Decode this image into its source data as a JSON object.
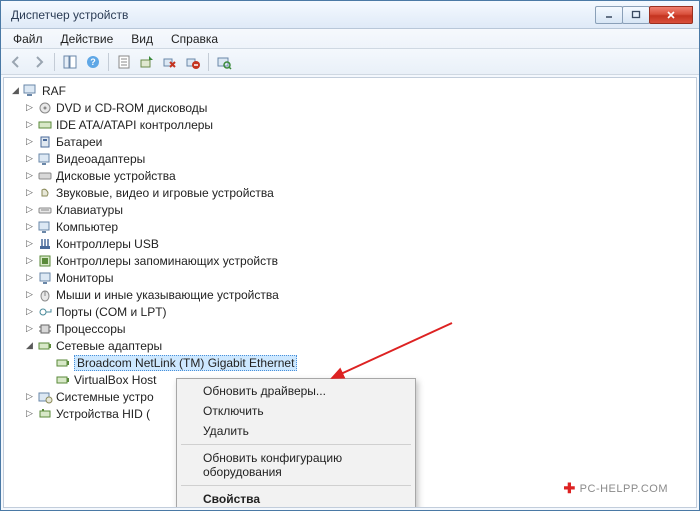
{
  "window": {
    "title": "Диспетчер устройств"
  },
  "menubar": [
    "Файл",
    "Действие",
    "Вид",
    "Справка"
  ],
  "tree": {
    "root": "RAF",
    "nodes": [
      "DVD и CD-ROM дисководы",
      "IDE ATA/ATAPI контроллеры",
      "Батареи",
      "Видеоадаптеры",
      "Дисковые устройства",
      "Звуковые, видео и игровые устройства",
      "Клавиатуры",
      "Компьютер",
      "Контроллеры USB",
      "Контроллеры запоминающих устройств",
      "Мониторы",
      "Мыши и иные указывающие устройства",
      "Порты (COM и LPT)",
      "Процессоры"
    ],
    "expanded_node": "Сетевые адаптеры",
    "expanded_children": [
      "Broadcom NetLink (TM) Gigabit Ethernet",
      "VirtualBox Host"
    ],
    "after_nodes": [
      "Системные устро",
      "Устройства HID ("
    ]
  },
  "context_menu": {
    "items": [
      "Обновить драйверы...",
      "Отключить",
      "Удалить"
    ],
    "item_config": "Обновить конфигурацию оборудования",
    "item_props": "Свойства"
  },
  "watermark": "PC-HELPP.COM"
}
